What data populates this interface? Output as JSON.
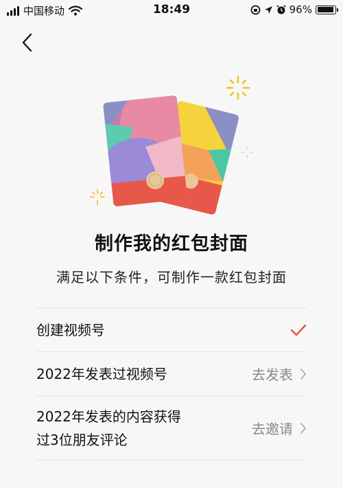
{
  "status_bar": {
    "carrier": "中国移动",
    "time": "18:49",
    "battery": "96%",
    "battery_level": 0.96
  },
  "page": {
    "title": "制作我的红包封面",
    "subtitle": "满足以下条件，可制作一款红包封面"
  },
  "conditions": [
    {
      "label": "创建视频号",
      "done": true,
      "action": ""
    },
    {
      "label": "2022年发表过视频号",
      "done": false,
      "action": "去发表"
    },
    {
      "label_line1": "2022年发表的内容获得",
      "label_line2": "过3位朋友评论",
      "done": false,
      "action": "去邀请"
    }
  ],
  "colors": {
    "check": "#e2553d",
    "chevron": "#b2b2b2",
    "background": "#f7f7f7",
    "divider": "#e3e3e3",
    "sparkle": "#f2c21b"
  },
  "icons": [
    "signal-icon",
    "wifi-icon",
    "orientation-lock-icon",
    "location-icon",
    "alarm-icon",
    "battery-icon",
    "back-icon",
    "check-icon",
    "chevron-right-icon"
  ]
}
